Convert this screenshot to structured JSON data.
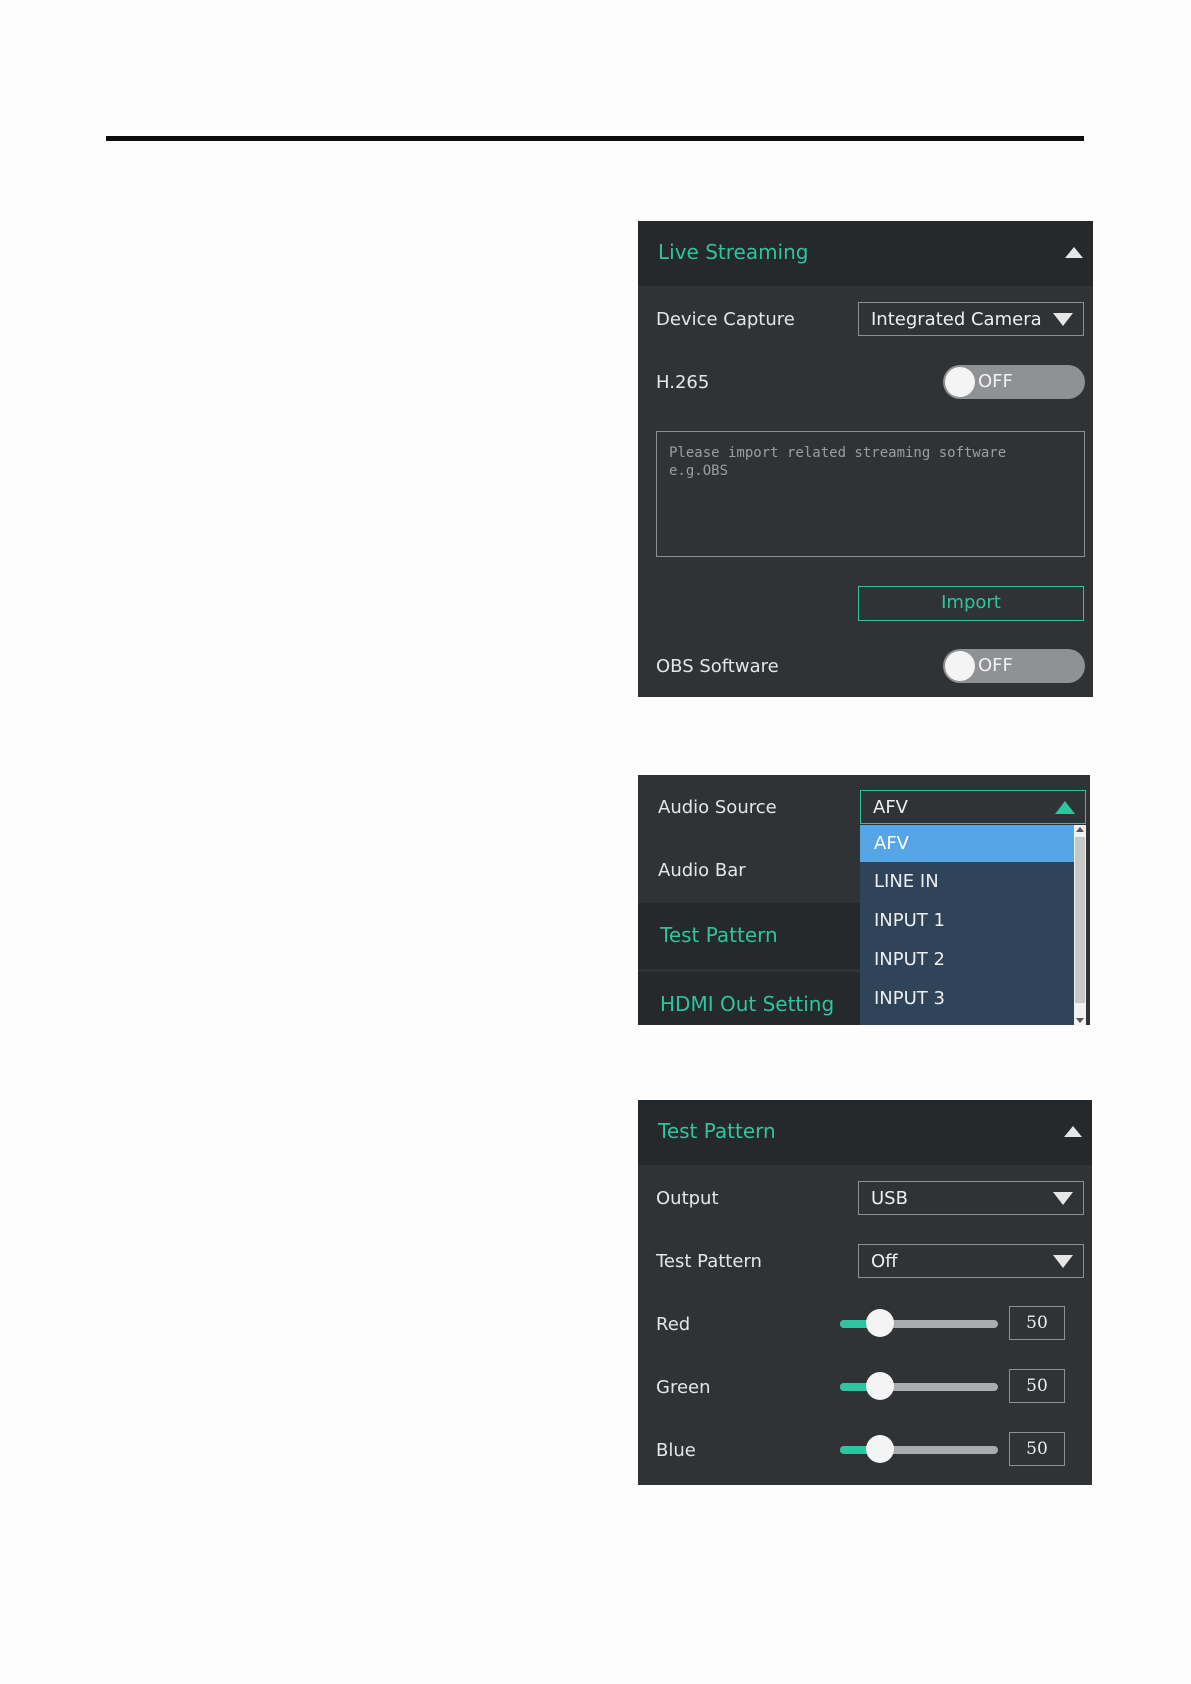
{
  "live_streaming": {
    "title": "Live Streaming",
    "device_capture": {
      "label": "Device Capture",
      "value": "Integrated Camera"
    },
    "h265": {
      "label": "H.265",
      "state": "OFF"
    },
    "import_text": "Please import related streaming software\ne.g.OBS",
    "import_button": "Import",
    "obs": {
      "label": "OBS Software",
      "state": "OFF"
    }
  },
  "audio": {
    "source_label": "Audio Source",
    "source_value": "AFV",
    "bar_label": "Audio Bar",
    "options": [
      "AFV",
      "LINE IN",
      "INPUT 1",
      "INPUT 2",
      "INPUT 3"
    ],
    "selected_index": 0,
    "test_pattern_label": "Test Pattern",
    "hdmi_label": "HDMI Out Setting"
  },
  "test_pattern": {
    "title": "Test Pattern",
    "output": {
      "label": "Output",
      "value": "USB"
    },
    "pattern": {
      "label": "Test Pattern",
      "value": "Off"
    },
    "sliders": [
      {
        "label": "Red",
        "value": "50",
        "fraction": 0.25
      },
      {
        "label": "Green",
        "value": "50",
        "fraction": 0.25
      },
      {
        "label": "Blue",
        "value": "50",
        "fraction": 0.25
      }
    ]
  },
  "colors": {
    "accent": "#2ec4a0",
    "panel_bg": "#303336",
    "header_bg": "#26292c",
    "selected_option": "#56a5e6"
  }
}
